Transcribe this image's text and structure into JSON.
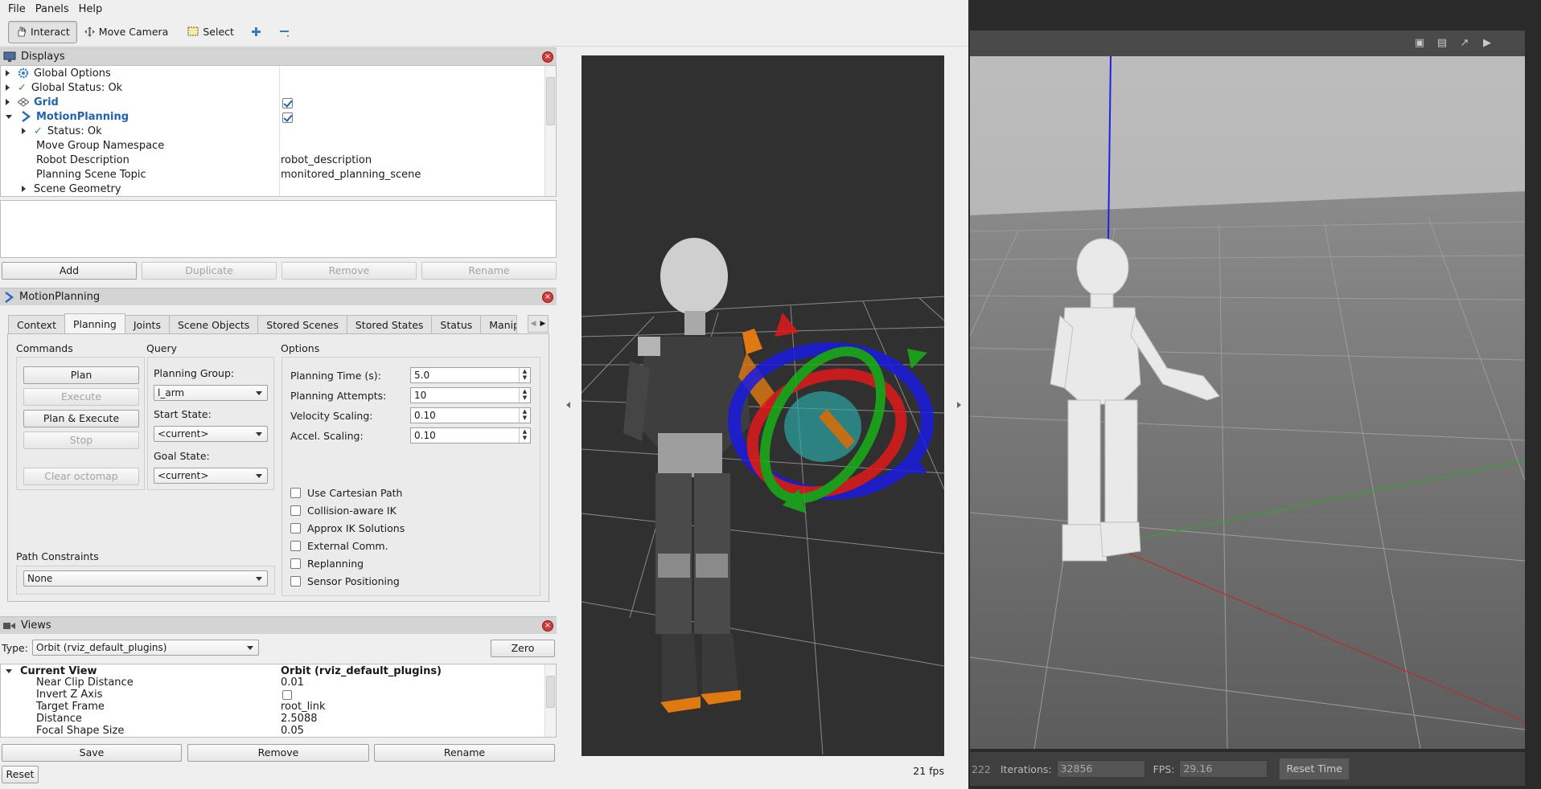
{
  "menu": [
    "File",
    "Panels",
    "Help"
  ],
  "toolbar": {
    "interact": "Interact",
    "move_camera": "Move Camera",
    "select": "Select"
  },
  "displays": {
    "title": "Displays",
    "rows": {
      "global_options": "Global Options",
      "global_status": "Global Status: Ok",
      "grid": "Grid",
      "motion_planning": "MotionPlanning",
      "status": "Status: Ok",
      "move_group_ns": "Move Group Namespace",
      "robot_description": "Robot Description",
      "robot_description_value": "robot_description",
      "planning_scene_topic": "Planning Scene Topic",
      "planning_scene_topic_value": "monitored_planning_scene",
      "scene_geometry": "Scene Geometry"
    },
    "grid_enabled": true,
    "motion_planning_enabled": true,
    "buttons": {
      "add": "Add",
      "duplicate": "Duplicate",
      "remove": "Remove",
      "rename": "Rename"
    }
  },
  "motion_planning": {
    "title": "MotionPlanning",
    "tabs": [
      "Context",
      "Planning",
      "Joints",
      "Scene Objects",
      "Stored Scenes",
      "Stored States",
      "Status",
      "Manipi"
    ],
    "active_tab": "Planning",
    "commands": {
      "title": "Commands",
      "plan": "Plan",
      "execute": "Execute",
      "plan_execute": "Plan & Execute",
      "stop": "Stop",
      "clear_octomap": "Clear octomap"
    },
    "query": {
      "title": "Query",
      "planning_group_label": "Planning Group:",
      "planning_group": "l_arm",
      "start_state_label": "Start State:",
      "start_state": "<current>",
      "goal_state_label": "Goal State:",
      "goal_state": "<current>"
    },
    "options": {
      "title": "Options",
      "planning_time_label": "Planning Time (s):",
      "planning_time": "5.0",
      "planning_attempts_label": "Planning Attempts:",
      "planning_attempts": "10",
      "velocity_scaling_label": "Velocity Scaling:",
      "velocity_scaling": "0.10",
      "accel_scaling_label": "Accel. Scaling:",
      "accel_scaling": "0.10",
      "checkboxes": [
        "Use Cartesian Path",
        "Collision-aware IK",
        "Approx IK Solutions",
        "External Comm.",
        "Replanning",
        "Sensor Positioning"
      ]
    },
    "path_constraints_label": "Path Constraints",
    "path_constraints": "None"
  },
  "views": {
    "title": "Views",
    "type_label": "Type:",
    "type_value": "Orbit (rviz_default_plugins)",
    "zero": "Zero",
    "current_view": "Current View",
    "current_view_value": "Orbit (rviz_default_plugins)",
    "props": [
      {
        "name": "Near Clip Distance",
        "value": "0.01"
      },
      {
        "name": "Invert Z Axis",
        "value": ""
      },
      {
        "name": "Target Frame",
        "value": "root_link"
      },
      {
        "name": "Distance",
        "value": "2.5088"
      },
      {
        "name": "Focal Shape Size",
        "value": "0.05"
      }
    ],
    "buttons": {
      "save": "Save",
      "remove": "Remove",
      "rename": "Rename"
    },
    "reset": "Reset"
  },
  "viewport": {
    "fps": "21 fps"
  },
  "gazebo": {
    "iterations_partial": "222",
    "iterations_label": "Iterations:",
    "iterations": "32856",
    "fps_label": "FPS:",
    "fps": "29.16",
    "reset_time": "Reset Time",
    "icons": [
      "camera-icon",
      "log-icon",
      "plot-icon",
      "video-icon"
    ]
  }
}
